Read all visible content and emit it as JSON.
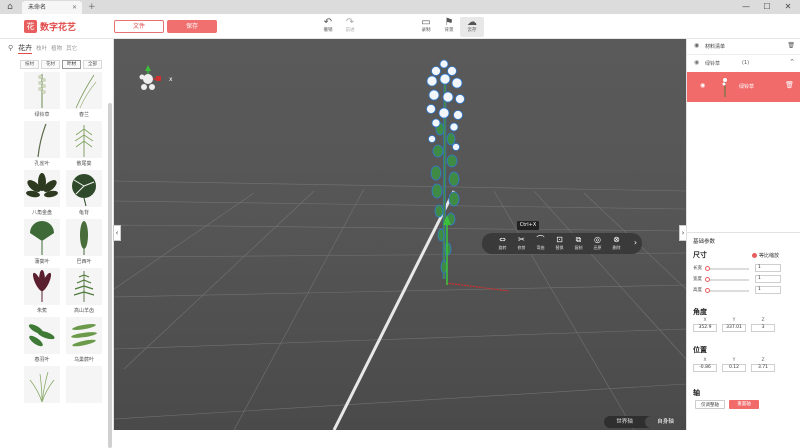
{
  "titlebar": {
    "tab_title": "未命名",
    "close": "✕",
    "add": "+",
    "min": "—",
    "max": "☐",
    "win_close": "✕"
  },
  "toolbar": {
    "logo_mark": "花",
    "app_name": "数字花艺",
    "file_label": "文件",
    "save_label": "保存",
    "tools": [
      {
        "label": "撤销",
        "icon": "↶"
      },
      {
        "label": "前进",
        "icon": "↷"
      },
      {
        "label": "录制",
        "icon": "▭"
      },
      {
        "label": "背景",
        "icon": "⚑"
      },
      {
        "label": "云存",
        "icon": "☁"
      }
    ]
  },
  "left": {
    "categories": [
      {
        "label": "花卉",
        "active": true
      },
      {
        "label": "枝叶",
        "active": false
      },
      {
        "label": "植物",
        "active": false
      },
      {
        "label": "其它",
        "active": false
      }
    ],
    "subtabs": [
      "枝材",
      "花材",
      "叶材",
      "全部"
    ],
    "items": [
      "绿铃草",
      "春兰",
      "孔雀叶",
      "散尾葵",
      "八角金盘",
      "龟背",
      "蒲葵叶",
      "巴西叶",
      "朱蕉",
      "高山羊齿",
      "春羽叶",
      "乌巢蕨叶"
    ]
  },
  "viewport": {
    "tooltip": "Ctrl+X",
    "context_menu": [
      {
        "label": "旋转",
        "icon": "⇔"
      },
      {
        "label": "修剪",
        "icon": "✂"
      },
      {
        "label": "弯曲",
        "icon": "⌒"
      },
      {
        "label": "替换",
        "icon": "⊡"
      },
      {
        "label": "复制",
        "icon": "⧉"
      },
      {
        "label": "还原",
        "icon": "◎"
      },
      {
        "label": "删除",
        "icon": "⊗"
      }
    ],
    "more": "›",
    "collapse_left": "‹",
    "collapse_right": "›",
    "axis_world": "世界轴",
    "axis_self": "自身轴",
    "gizmo_x": "x"
  },
  "right": {
    "list_title": "材料清单",
    "group_name": "绿铃草",
    "group_count": "(1)",
    "item_name": "绿铃草",
    "section_title": "基础参数",
    "size_title": "尺寸",
    "ratio_label": "等比缩放",
    "sliders": [
      {
        "label": "长宽",
        "value": "1",
        "level": 0.0
      },
      {
        "label": "宽度",
        "value": "1",
        "level": 0.0
      },
      {
        "label": "高度",
        "value": "1",
        "level": 0.0
      }
    ],
    "angle_title": "角度",
    "angle": {
      "x": "352.9",
      "y": "337.01",
      "z": "3"
    },
    "pos_title": "位置",
    "position": {
      "x": "-0.86",
      "y": "0.12",
      "z": "3.71"
    },
    "axis_title": "轴",
    "axis_btn1": "仅调整轴",
    "axis_btn2": "重置轴",
    "xyz": [
      "X",
      "Y",
      "Z"
    ]
  },
  "colors": {
    "accent": "#f26b6b",
    "viewport": "#555555"
  }
}
